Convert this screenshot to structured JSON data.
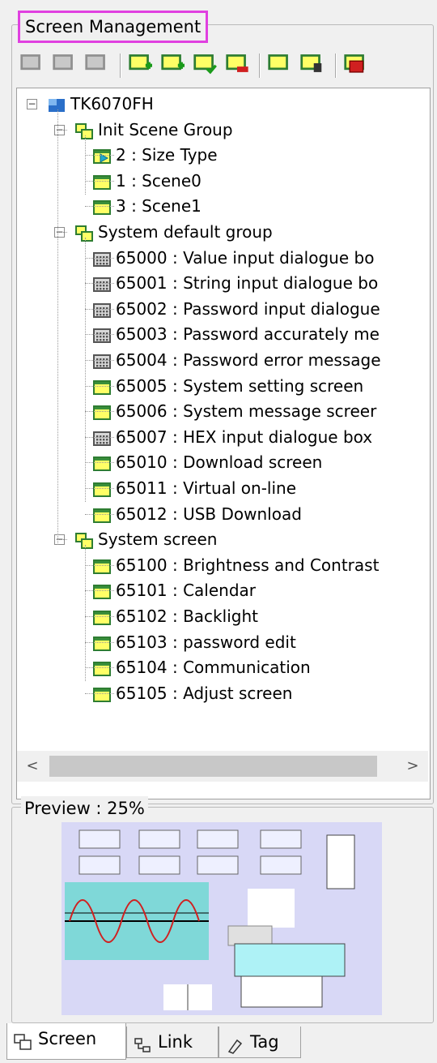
{
  "panel": {
    "title": "Screen Management"
  },
  "toolbar": {
    "buttons": [
      {
        "icon": "copy-screen-icon",
        "enabled": false
      },
      {
        "icon": "cut-screen-icon",
        "enabled": false
      },
      {
        "icon": "paste-screen-icon",
        "enabled": false
      },
      {
        "icon": "add-screen-icon",
        "enabled": true
      },
      {
        "icon": "add-screen-group-icon",
        "enabled": true
      },
      {
        "icon": "set-init-screen-icon",
        "enabled": true
      },
      {
        "icon": "delete-screen-icon",
        "enabled": true
      },
      {
        "icon": "screen-properties-icon",
        "enabled": true
      },
      {
        "icon": "lock-screen-icon",
        "enabled": true
      },
      {
        "icon": "screen-tree-icon",
        "enabled": true
      }
    ]
  },
  "tree": {
    "root": {
      "label": "TK6070FH",
      "icon": "hmi-device-icon"
    },
    "groups": [
      {
        "label": "Init Scene Group",
        "items": [
          {
            "label": "2 : Size Type",
            "icon": "init-screen-icon"
          },
          {
            "label": "1 : Scene0",
            "icon": "screen-icon"
          },
          {
            "label": "3 : Scene1",
            "icon": "screen-icon"
          }
        ]
      },
      {
        "label": "System default group",
        "items": [
          {
            "label": "65000 : Value input dialogue bo",
            "icon": "dialog-screen-icon"
          },
          {
            "label": "65001 : String input dialogue bo",
            "icon": "dialog-screen-icon"
          },
          {
            "label": "65002 : Password input dialogue",
            "icon": "dialog-screen-icon"
          },
          {
            "label": "65003 : Password accurately me",
            "icon": "dialog-screen-icon"
          },
          {
            "label": "65004 : Password error message",
            "icon": "dialog-screen-icon"
          },
          {
            "label": "65005 : System setting screen",
            "icon": "screen-icon"
          },
          {
            "label": "65006 : System message screer",
            "icon": "screen-icon"
          },
          {
            "label": "65007 : HEX input dialogue box",
            "icon": "dialog-screen-icon"
          },
          {
            "label": "65010 : Download screen",
            "icon": "screen-icon"
          },
          {
            "label": "65011 : Virtual on-line",
            "icon": "screen-icon"
          },
          {
            "label": "65012 : USB Download",
            "icon": "screen-icon"
          }
        ]
      },
      {
        "label": "System screen",
        "items": [
          {
            "label": "65100 : Brightness and Contrast",
            "icon": "screen-icon"
          },
          {
            "label": "65101 : Calendar",
            "icon": "screen-icon"
          },
          {
            "label": "65102 : Backlight",
            "icon": "screen-icon"
          },
          {
            "label": "65103 : password edit",
            "icon": "screen-icon"
          },
          {
            "label": "65104 : Communication",
            "icon": "screen-icon"
          },
          {
            "label": "65105 : Adjust screen",
            "icon": "screen-icon"
          }
        ]
      }
    ]
  },
  "scrollbar": {
    "left_arrow": "<",
    "right_arrow": ">"
  },
  "preview": {
    "title": "Preview : 25%"
  },
  "tabs": [
    {
      "label": "Screen",
      "icon": "screen-tab-icon",
      "active": true
    },
    {
      "label": "Link",
      "icon": "link-tab-icon",
      "active": false
    },
    {
      "label": "Tag",
      "icon": "tag-tab-icon",
      "active": false
    }
  ],
  "colors": {
    "highlight_border": "#e040e0",
    "screen_icon_fill": "#ffff66",
    "screen_icon_border": "#2e7d32",
    "preview_background": "#d8d8f6"
  }
}
